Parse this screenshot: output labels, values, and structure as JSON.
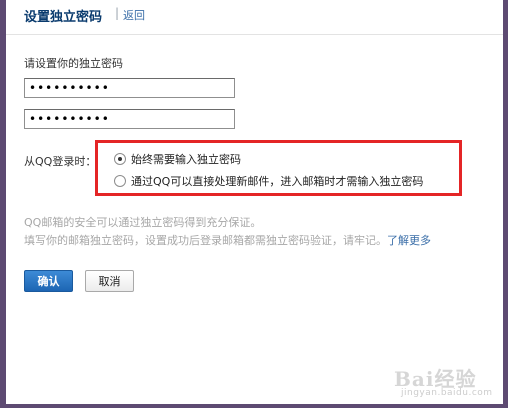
{
  "header": {
    "title": "设置独立密码",
    "separator": "|",
    "back_label": "返回"
  },
  "form": {
    "prompt": "请设置你的独立密码",
    "password1_value": "••••••••••",
    "password2_value": "••••••••••",
    "qq_login_label": "从QQ登录时：",
    "options": [
      {
        "label": "始终需要输入独立密码",
        "checked": true
      },
      {
        "label": "通过QQ可以直接处理新邮件，进入邮箱时才需输入独立密码",
        "checked": false
      }
    ]
  },
  "notes": {
    "line1": "QQ邮箱的安全可以通过独立密码得到充分保证。",
    "line2": "填写你的邮箱独立密码，设置成功后登录邮箱都需独立密码验证，请牢记。",
    "learn_more": "了解更多"
  },
  "buttons": {
    "confirm": "确认",
    "cancel": "取消"
  },
  "watermark": {
    "text": "Bai经验",
    "sub": "jingyan.baidu.com"
  },
  "colors": {
    "highlight": "#e42526",
    "link": "#3a6ea8",
    "title": "#0a3b6e",
    "primary_button": "#1d65b3"
  }
}
